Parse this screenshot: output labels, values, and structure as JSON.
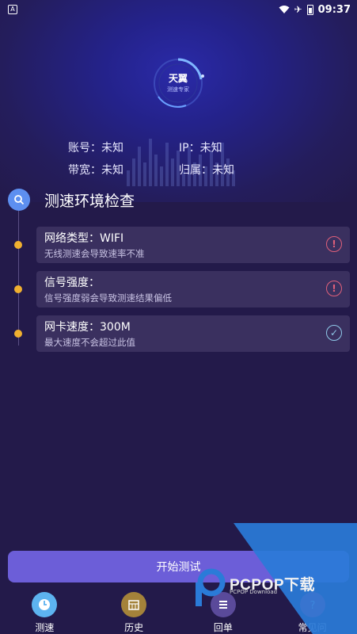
{
  "status_bar": {
    "time": "09:37",
    "icons": [
      "notification-icon",
      "wifi-icon",
      "airplane-icon",
      "battery-icon"
    ]
  },
  "logo": {
    "title": "天翼",
    "subtitle": "测速专家"
  },
  "info": {
    "account_label": "账号：未知",
    "ip_label": "IP：未知",
    "bandwidth_label": "带宽：未知",
    "belong_label": "归属：未知"
  },
  "section": {
    "title": "测速环境检查"
  },
  "checks": [
    {
      "title": "网络类型：WIFI",
      "desc": "无线测速会导致速率不准",
      "status": "warning"
    },
    {
      "title": "信号强度：",
      "desc": "信号强度弱会导致测速结果偏低",
      "status": "warning"
    },
    {
      "title": "网卡速度：300M",
      "desc": "最大速度不会超过此值",
      "status": "ok"
    }
  ],
  "start_button": "开始测试",
  "tabs": [
    {
      "label": "测速",
      "icon": "clock-icon",
      "color": "#5db3f0"
    },
    {
      "label": "历史",
      "icon": "calendar-icon",
      "color": "#a4823a"
    },
    {
      "label": "回单",
      "icon": "list-icon",
      "color": "#5a4a9a"
    },
    {
      "label": "常见问",
      "icon": "question-icon",
      "color": "#d0306a"
    }
  ],
  "watermark": {
    "text": "PCPOP下载",
    "sub": "PCPOP Download"
  },
  "colors": {
    "background": "#231a4a",
    "card": "#3a305f",
    "button": "#6c5ed8",
    "dot": "#f0b030",
    "warning": "#e0607a",
    "ok": "#8fc8e8"
  }
}
